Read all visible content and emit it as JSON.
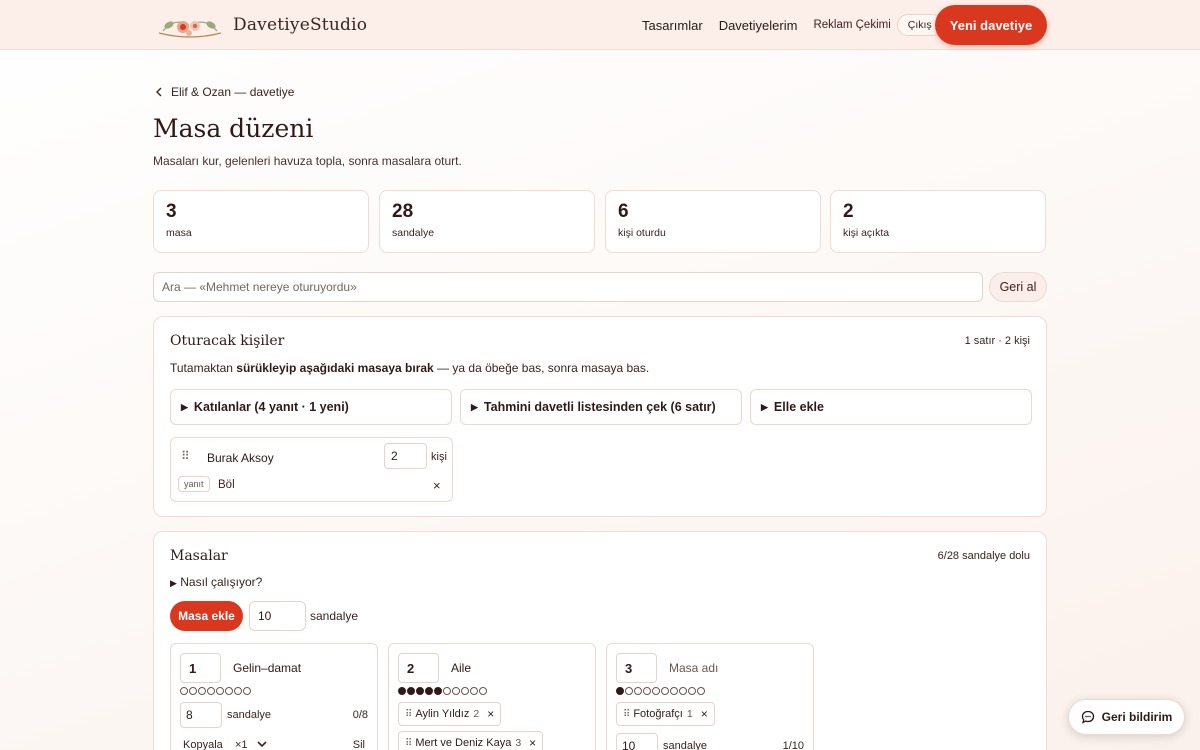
{
  "header": {
    "brand": "DavetiyeStudio",
    "nav": [
      "Tasarımlar",
      "Davetiyelerim"
    ],
    "user": "Reklam Çekimi",
    "logout": "Çıkış",
    "new_invite": "Yeni davetiye"
  },
  "breadcrumb": "Elif & Ozan — davetiye",
  "page": {
    "title": "Masa düzeni",
    "subtitle": "Masaları kur, gelenleri havuza topla, sonra masalara oturt."
  },
  "stats": [
    {
      "value": "3",
      "label": "masa"
    },
    {
      "value": "28",
      "label": "sandalye"
    },
    {
      "value": "6",
      "label": "kişi oturdu"
    },
    {
      "value": "2",
      "label": "kişi açıkta"
    }
  ],
  "search": {
    "placeholder": "Ara — «Mehmet nereye oturuyordu»",
    "undo": "Geri al"
  },
  "pool": {
    "title": "Oturacak kişiler",
    "meta": "1 satır · 2 kişi",
    "hint_pre": "Tutamaktan ",
    "hint_bold": "sürükleyip aşağıdaki masaya bırak",
    "hint_post": " — ya da öbeğe bas, sonra masaya bas.",
    "sources": [
      "Katılanlar (4 yanıt · 1 yeni)",
      "Tahmini davetli listesinden çek (6 satır)",
      "Elle ekle"
    ],
    "guest": {
      "name": "Burak Aksoy",
      "count": "2",
      "unit": "kişi",
      "tag": "yanıt",
      "split": "Böl"
    }
  },
  "tables_panel": {
    "title": "Masalar",
    "meta": "6/28 sandalye dolu",
    "howto": "Nasıl çalışıyor?",
    "add_button": "Masa ekle",
    "default_seats": "10",
    "seats_unit": "sandalye",
    "tables": [
      {
        "number": "1",
        "name": "Gelin–damat",
        "seats": "8",
        "fill": "0/8",
        "capacity": 8,
        "occupied": 0,
        "guests": [],
        "footer": {
          "copy": "Kopyala",
          "multiplier": "×1",
          "delete": "Sil"
        }
      },
      {
        "number": "2",
        "name": "Aile",
        "seats": "10",
        "fill": "5/10",
        "capacity": 10,
        "occupied": 5,
        "guests": [
          {
            "name": "Aylin Yıldız",
            "count": "2"
          },
          {
            "name": "Mert ve Deniz Kaya",
            "count": "3"
          }
        ]
      },
      {
        "number": "3",
        "name": "",
        "name_placeholder": "Masa adı",
        "seats": "10",
        "fill": "1/10",
        "capacity": 10,
        "occupied": 1,
        "guests": [
          {
            "name": "Fotoğrafçı",
            "count": "1"
          }
        ]
      }
    ]
  },
  "feedback": "Geri bildirim",
  "icons": {
    "back": "chevron-left-icon",
    "disclosure": "triangle-right-icon",
    "grip": "drag-handle-icon",
    "remove": "close-icon",
    "feedback": "chat-bubble-icon"
  },
  "colors": {
    "accent": "#d9381e",
    "header_bg": "#fcefe9",
    "text": "#2f1a18",
    "border": "#efdcd5"
  }
}
